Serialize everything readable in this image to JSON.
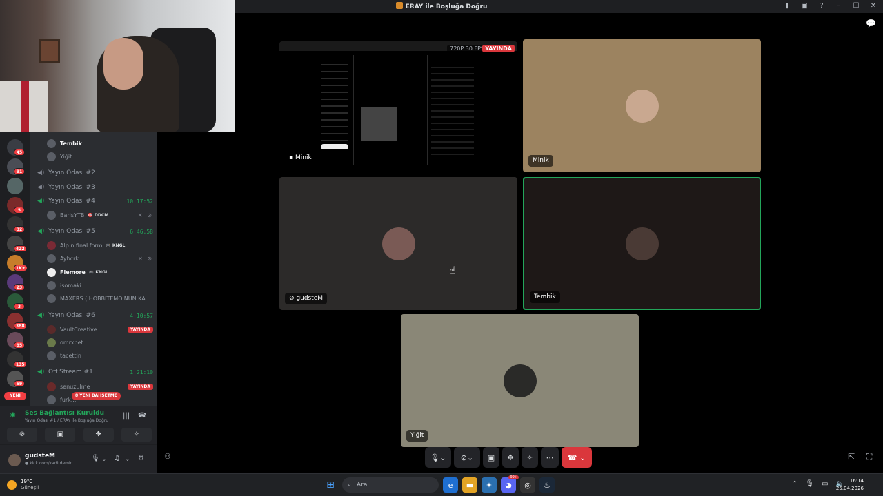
{
  "window": {
    "title": "ERAY ile Boşluğa Doğru",
    "icons": [
      "inbox-icon",
      "screen-icon",
      "help-icon",
      "minimize-icon",
      "maximize-icon",
      "close-icon"
    ]
  },
  "server_badges": [
    "45",
    "91",
    "",
    "5",
    "32",
    "422",
    "1K+",
    "23",
    "3",
    "388",
    "95",
    "135",
    "59"
  ],
  "server_new": "YENİ",
  "channels": {
    "pre_users": [
      {
        "name": "Tembik"
      },
      {
        "name": "Yiğit"
      }
    ],
    "rooms": [
      {
        "name": "Yayın Odası #2",
        "time": "",
        "users": []
      },
      {
        "name": "Yayın Odası #3",
        "time": "",
        "users": []
      },
      {
        "name": "Yayın Odası #4",
        "time": "10:17:52",
        "users": [
          {
            "name": "BarisYTB",
            "tag": "🎯 DDCM",
            "icons": "✕ ⊘"
          }
        ]
      },
      {
        "name": "Yayın Odası #5",
        "time": "6:46:58",
        "users": [
          {
            "name": "Alp n final form",
            "tag": "🎮 KNGL"
          },
          {
            "name": "Aybcrk",
            "icons": "✕ ⊘"
          },
          {
            "name": "Flemore",
            "tag": "🎮 KNGL"
          },
          {
            "name": "isomaki"
          },
          {
            "name": "MAXERS ( HOBBİTEMO'NUN KAR..."
          }
        ]
      },
      {
        "name": "Yayın Odası #6",
        "time": "4:10:57",
        "users": [
          {
            "name": "VaultCreative",
            "live": "YAYINDA"
          },
          {
            "name": "omrxbet"
          },
          {
            "name": "tacettin"
          }
        ]
      },
      {
        "name": "Off Stream #1",
        "time": "1:21:10",
        "users": [
          {
            "name": "senuzulme",
            "live": "YAYINDA"
          },
          {
            "name": "furk..."
          }
        ]
      }
    ],
    "new_mentions": "8 YENİ BAHSETME"
  },
  "voice": {
    "status": "Ses Bağlantısı Kuruldu",
    "channel": "Yayın Odası #1 / ERAY ile Boşluğa Doğru"
  },
  "user": {
    "name": "gudsteM",
    "sub": "● kick.com/kadirdemir"
  },
  "tiles": [
    {
      "label": "Minik",
      "badge_quality": "720P 30 FPS",
      "badge_live": "YAYINDA"
    },
    {
      "label": "Minik"
    },
    {
      "label": "gudsteM"
    },
    {
      "label": "Tembik"
    },
    {
      "label": "Yiğit"
    }
  ],
  "taskbar": {
    "temp": "19°C",
    "weather": "Güneşli",
    "search": "Ara",
    "time": "16:14",
    "date": "25.04.2026",
    "discord_badge": "99+"
  },
  "colors": {
    "green": "#23a55a",
    "red": "#da373c",
    "bg": "#000000"
  }
}
